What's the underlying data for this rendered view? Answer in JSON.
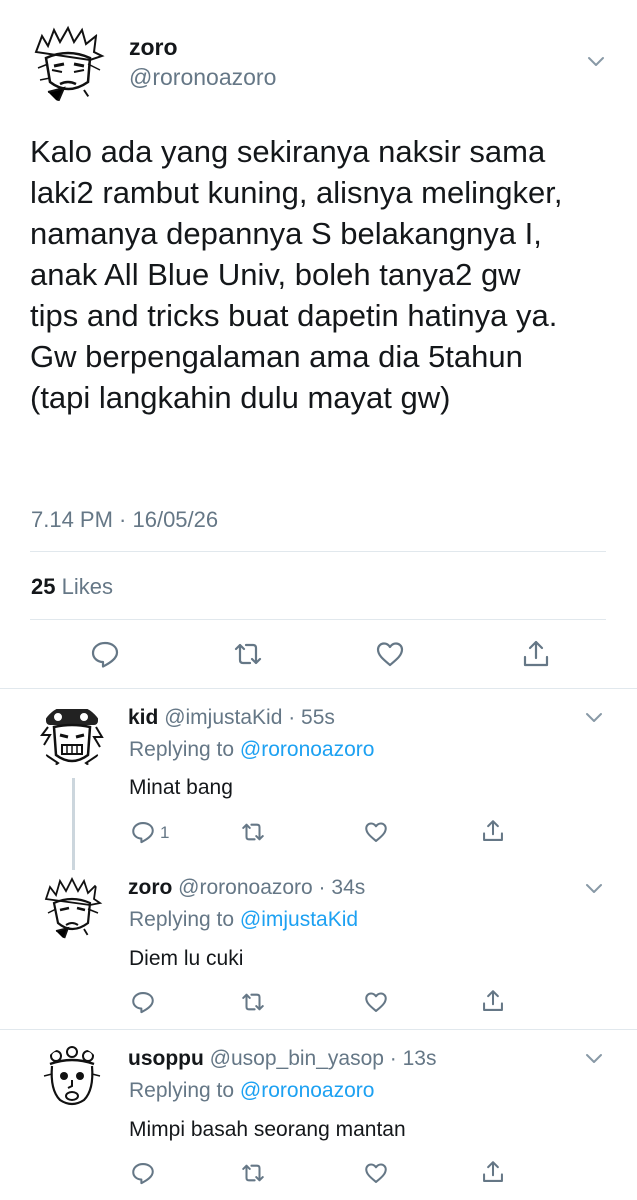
{
  "main": {
    "name": "zoro",
    "handle": "@roronoazoro",
    "text_lines": [
      "Kalo ada yang sekiranya naksir sama",
      "laki2 rambut kuning, alisnya melingker,",
      "namanya depannya S belakangnya I,",
      "anak All Blue Univ, boleh tanya2 gw",
      "tips and tricks buat dapetin hatinya ya.",
      "Gw berpengalaman ama dia 5tahun",
      "(tapi langkahin dulu mayat gw)"
    ],
    "time": "7.14 PM · 16/05/26",
    "likes_count": "25",
    "likes_label": "Likes"
  },
  "replies": [
    {
      "name": "kid",
      "handle_time": "@imjustaKid · 55s",
      "replying_label": "Replying to",
      "replying_to": "@roronoazoro",
      "text": "Minat bang",
      "reply_count": "1"
    },
    {
      "name": "zoro",
      "handle_time": "@roronoazoro · 34s",
      "replying_label": "Replying to",
      "replying_to": "@imjustaKid",
      "text": "Diem lu cuki",
      "reply_count": ""
    },
    {
      "name": "usoppu",
      "handle_time": "@usop_bin_yasop · 13s",
      "replying_label": "Replying to",
      "replying_to": "@roronoazoro",
      "text": "Mimpi basah seorang mantan",
      "reply_count": ""
    }
  ],
  "icons": [
    "chevron-down-icon",
    "reply-icon",
    "retweet-icon",
    "like-icon",
    "share-icon"
  ],
  "colors": {
    "text": "#14171a",
    "muted": "#657786",
    "link": "#1da1f2",
    "divider": "#e1e8ed"
  }
}
